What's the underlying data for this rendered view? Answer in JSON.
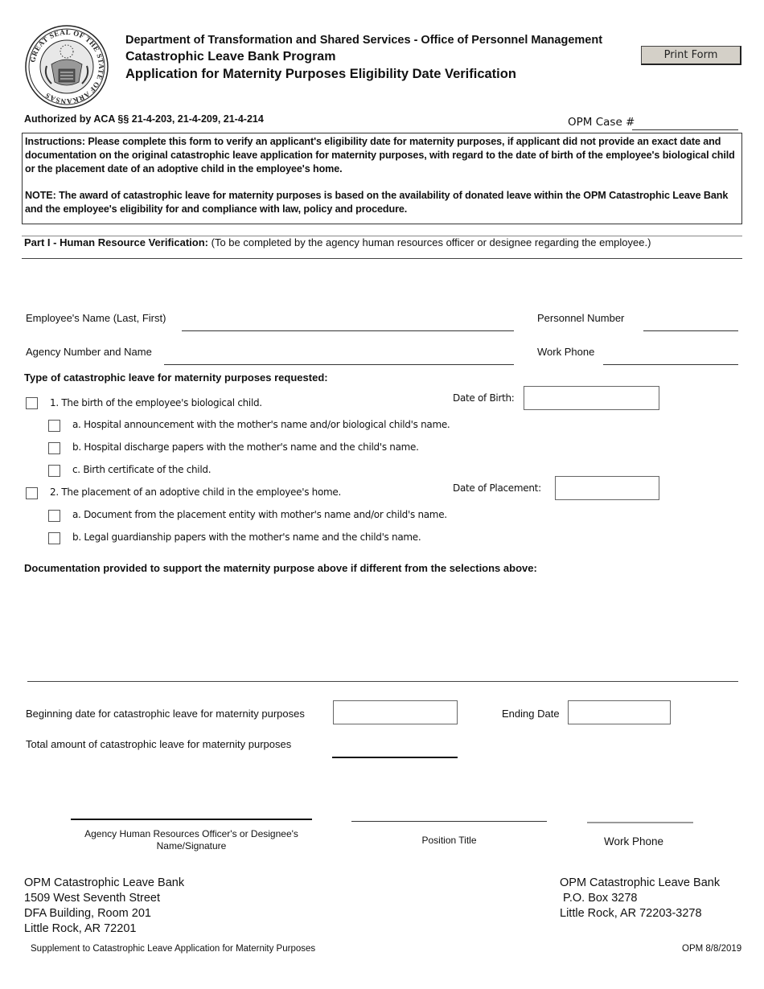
{
  "header": {
    "seal_icon": "great-seal-of-arkansas",
    "seal_text": "GREAT SEAL OF THE STATE OF ARKANSAS",
    "line1": "Department of Transformation and Shared Services - Office of Personnel Management",
    "line2": "Catastrophic Leave Bank Program",
    "line3": "Application for Maternity Purposes Eligibility Date Verification",
    "print_button": "Print Form"
  },
  "authorization": "Authorized by ACA §§ 21-4-203, 21-4-209, 21-4-214",
  "opm_case": {
    "label": "OPM Case #",
    "value": ""
  },
  "instructions": {
    "paragraph1": "Instructions:  Please complete this form to verify an applicant's eligibility date for maternity purposes, if applicant did not provide an exact date and documentation on the original catastrophic leave application for maternity purposes, with regard to the date of birth of the employee's biological child or the placement date of an adoptive child in the employee's home.",
    "paragraph2": "NOTE:  The award of catastrophic leave for maternity purposes is based on the availability of donated leave within the OPM Catastrophic Leave Bank and the employee's eligibility for and compliance with law, policy and procedure."
  },
  "part1": {
    "title": "Part I - Human Resource Verification:",
    "subtitle": " (To be completed by the agency human resources officer or designee regarding the employee.)"
  },
  "fields": {
    "employee_name": {
      "label": "Employee's Name (Last, First)",
      "value": ""
    },
    "personnel_number": {
      "label": "Personnel Number",
      "value": ""
    },
    "agency": {
      "label": "Agency Number and Name",
      "value": ""
    },
    "work_phone": {
      "label": "Work Phone",
      "value": ""
    }
  },
  "leave_type": {
    "heading": "Type of catastrophic leave for maternity purposes requested:",
    "options": [
      {
        "label": "1.  The birth of the employee's biological child.",
        "checked": false,
        "date_label": "Date of Birth:",
        "date_value": ""
      },
      {
        "label": "a.  Hospital announcement with the mother's name and/or biological child's name.",
        "checked": false
      },
      {
        "label": "b.  Hospital discharge papers with the mother's name and the child's name.",
        "checked": false
      },
      {
        "label": "c.  Birth certificate of the child.",
        "checked": false
      },
      {
        "label": "2.  The placement of an adoptive child in the employee's home.",
        "checked": false,
        "date_label": "Date of Placement:",
        "date_value": ""
      },
      {
        "label": "a.  Document from the placement entity with mother's name and/or child's name.",
        "checked": false
      },
      {
        "label": "b.  Legal guardianship papers with the mother's name and the child's name.",
        "checked": false
      }
    ]
  },
  "documentation": {
    "heading": "Documentation provided to support the maternity purpose above if different from the selections above:",
    "value": ""
  },
  "dates": {
    "beginning_label": "Beginning date for catastrophic leave for maternity purposes",
    "beginning_value": "",
    "ending_label": "Ending Date",
    "ending_value": "",
    "total_label": "Total amount of catastrophic leave for maternity purposes",
    "total_value": ""
  },
  "signatures": {
    "officer_label_line1": "Agency Human Resources Officer's or Designee's",
    "officer_label_line2": "Name/Signature",
    "position_label": "Position Title",
    "phone_label": "Work Phone"
  },
  "addresses": {
    "left": [
      "OPM Catastrophic Leave Bank",
      "1509 West Seventh Street",
      "DFA Building, Room 201",
      "Little Rock, AR 72201"
    ],
    "right": [
      "OPM Catastrophic Leave Bank",
      " P.O. Box 3278",
      "Little Rock, AR 72203-3278"
    ]
  },
  "footer": {
    "left": "Supplement to Catastrophic Leave Application for Maternity Purposes",
    "right": "OPM 8/8/2019"
  }
}
